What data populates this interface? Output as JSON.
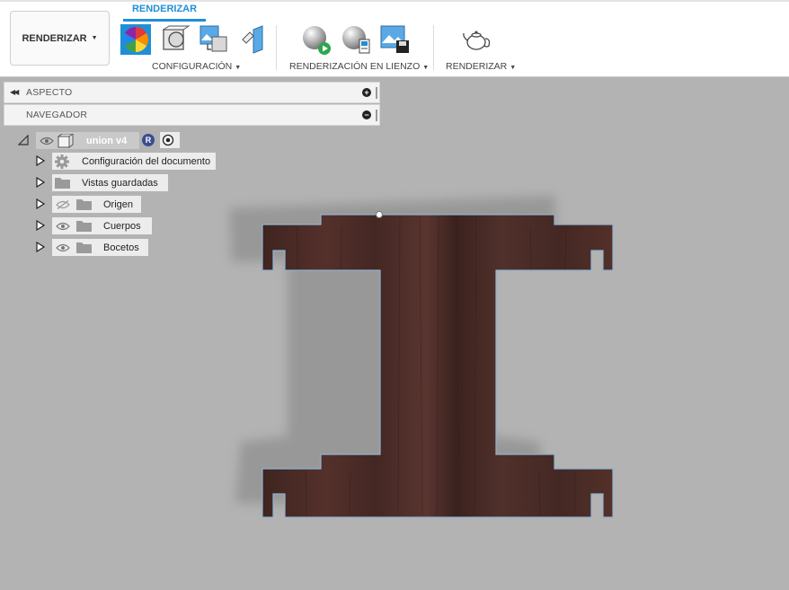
{
  "toolbar": {
    "workspace_label": "RENDERIZAR",
    "active_tab": "RENDERIZAR",
    "groups": {
      "config": "CONFIGURACIÓN",
      "canvas": "RENDERIZACIÓN EN LIENZO",
      "render": "RENDERIZAR"
    },
    "accent_color": "#1e8fd6"
  },
  "panels": {
    "aspecto": "ASPECTO",
    "navegador": "NAVEGADOR"
  },
  "browser": {
    "root": {
      "label": "union v4",
      "badge": "R"
    },
    "items": [
      {
        "label": "Configuración del documento",
        "icon": "gear-icon"
      },
      {
        "label": "Vistas guardadas",
        "icon": "folder-icon"
      },
      {
        "label": "Origen",
        "icon": "folder-icon",
        "visibility": "hidden"
      },
      {
        "label": "Cuerpos",
        "icon": "folder-icon",
        "visibility": "visible"
      },
      {
        "label": "Bocetos",
        "icon": "folder-icon",
        "visibility": "visible"
      }
    ]
  },
  "viewport": {
    "background_color": "#b3b3b3",
    "material_color": "#4a2b25"
  }
}
